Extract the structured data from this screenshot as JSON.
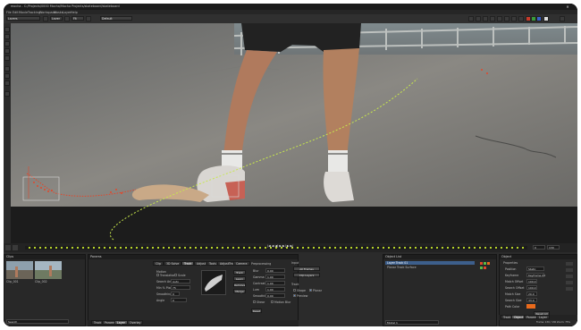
{
  "window": {
    "title": "mocha - C:/Projects/0000 Mocha/Mocha Projects/skateboard/skateboard",
    "close_glyph": "✕"
  },
  "menu": [
    "File",
    "Edit",
    "Movie",
    "Tracking",
    "Workspace",
    "Masks",
    "Layer",
    "Help"
  ],
  "toolbar": {
    "layer_mode": "Layers",
    "view_mode": "Layer",
    "zoom": "Fit",
    "color_space": "Default",
    "track_label": "Track",
    "track_mode": "Roto Layer",
    "adjust_label": "Adjust"
  },
  "viewer": {
    "frame_controls": "|◀ ◀ ◀| ▶ ▶| ▶ ▶|",
    "playback": {
      "start": "0",
      "end": "130"
    }
  },
  "clips_panel": {
    "title": "Clips",
    "items": [
      "Clip_001",
      "Clip_002"
    ],
    "search_placeholder": "Search",
    "tabs": [
      "Clips",
      "Movies"
    ]
  },
  "params_panel": {
    "title": "Params",
    "tabs": [
      "Clip",
      "3D Solve",
      "Track",
      "Adjust",
      "Tools",
      "AdjustTrack",
      "Camera"
    ],
    "active_tab": "Track",
    "bottom_tabs": [
      "Track",
      "Params",
      "Layer",
      "Overlay"
    ],
    "motion": {
      "label": "Motion",
      "options": [
        "Translation",
        "Scale",
        "Rotation",
        "Shear",
        "Perspective"
      ]
    },
    "search_area": {
      "label": "Search Area",
      "value": "Auto"
    },
    "min_pixels": {
      "label": "Min % Pixels",
      "value": "75"
    },
    "smoothing": {
      "label": "Smoothing",
      "value": "0"
    },
    "angle": {
      "label": "Angle",
      "value": "0"
    },
    "zoom_label": "Zoom %",
    "buttons": [
      "Track",
      "Learn",
      "Remove",
      "Merge"
    ],
    "preprocessing_title": "Preprocessing",
    "preprocessing": [
      {
        "label": "Blur",
        "value": "0.00"
      },
      {
        "label": "Gamma",
        "value": "1.00"
      },
      {
        "label": "Contrast",
        "value": "1.00"
      },
      {
        "label": "Lum",
        "value": "1.00"
      },
      {
        "label": "Smoothing",
        "value": "0.00"
      }
    ],
    "reset_label": "Reset",
    "input_title": "Input",
    "input_buttons": [
      "All Frames",
      "Clip Layers"
    ],
    "track_options": [
      "Shear",
      "Roto",
      "Motion Blur",
      "Perspective"
    ],
    "track_title": "Track",
    "track_checks": [
      "Shape",
      "Planar",
      "Preview"
    ]
  },
  "layers_panel": {
    "title": "Object List",
    "items": [
      "Layer Track 01",
      "Planar Track Surface"
    ],
    "footer": "Model 1"
  },
  "object_panel": {
    "title": "Object",
    "section": "Properties",
    "fields": [
      {
        "label": "Position",
        "value": "Static"
      },
      {
        "label": "Keyframe",
        "value": "Keyframe 01"
      },
      {
        "label": "Match Offset",
        "value": "100.0"
      },
      {
        "label": "Search Offset",
        "value": "100.0"
      },
      {
        "label": "Match Size",
        "value": "20.0"
      },
      {
        "label": "Search Size",
        "value": "33.0"
      },
      {
        "label": "Path Color",
        "value": ""
      }
    ],
    "reset_label": "Reset All",
    "bottom_tabs": [
      "Track",
      "Object",
      "Params",
      "Layer"
    ],
    "status": "Frame: 130 / 130  Zoom: 75%"
  },
  "colors": {
    "accent": "#e96a1c",
    "track_path": "#c8e84b",
    "track_dots_red": "#e2472b",
    "timeline_marks": "#b7d42a"
  }
}
